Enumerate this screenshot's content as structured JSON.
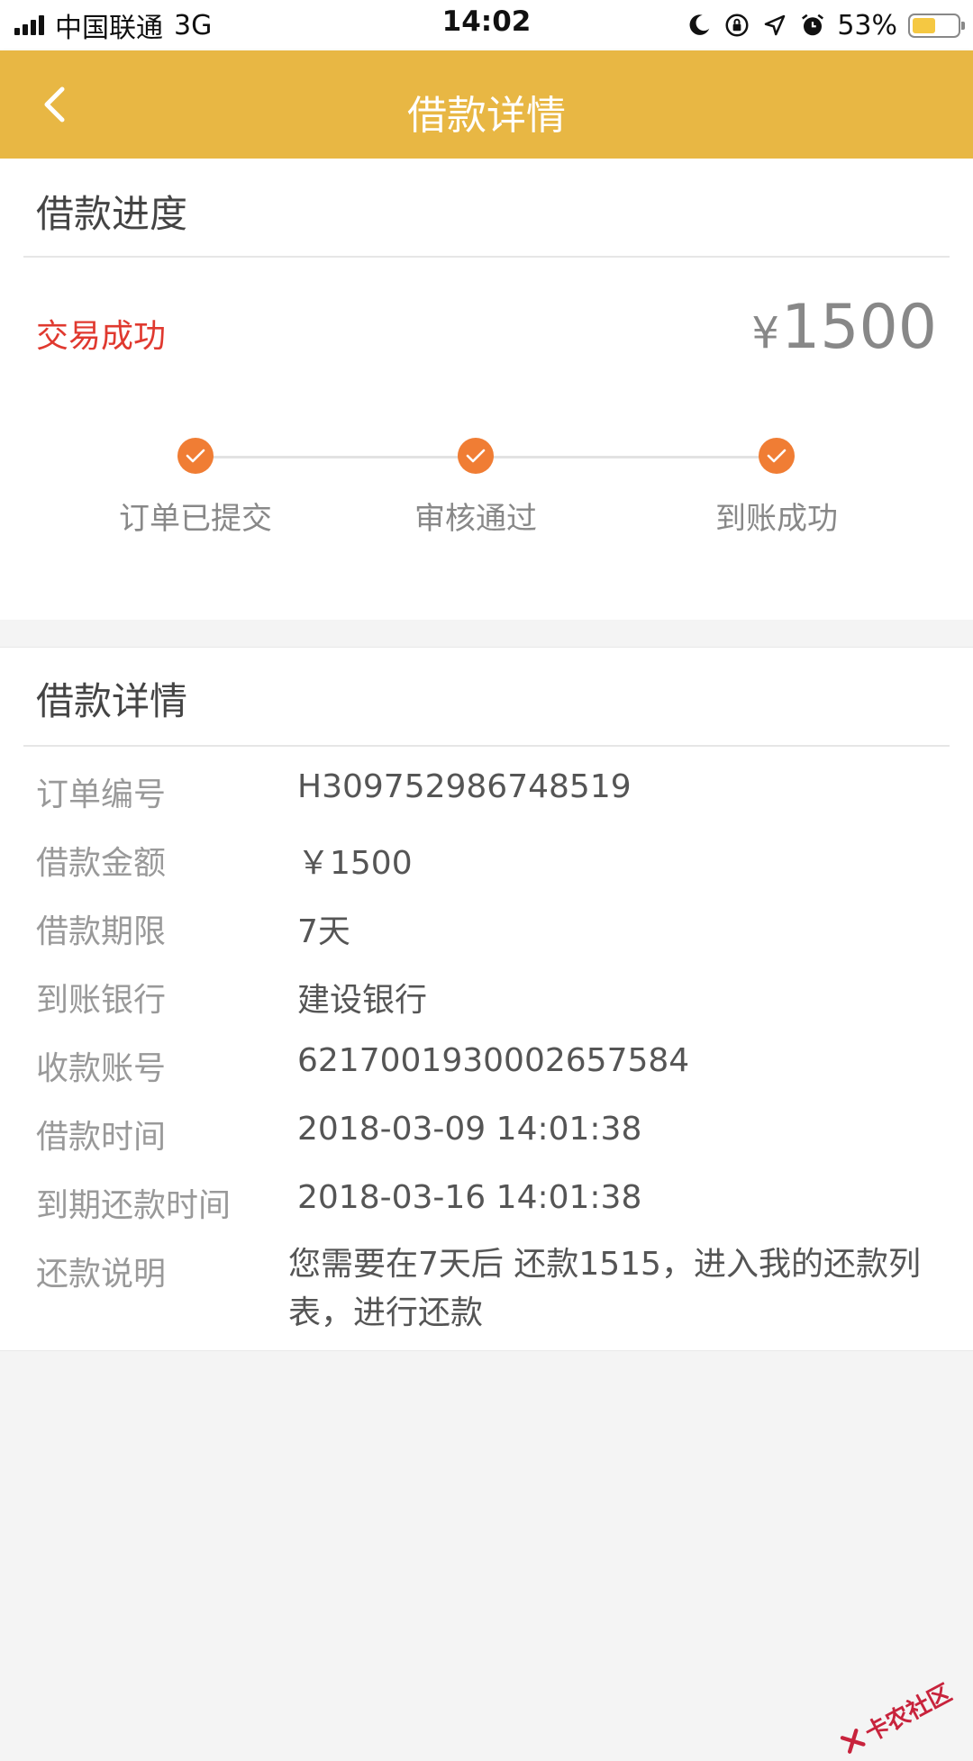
{
  "status_bar": {
    "carrier": "中国联通",
    "network": "3G",
    "time": "14:02",
    "battery_percent": "53%",
    "battery_level": 0.53
  },
  "header": {
    "title": "借款详情"
  },
  "progress": {
    "section_title": "借款进度",
    "status": "交易成功",
    "currency_symbol": "¥",
    "amount": "1500",
    "steps": [
      {
        "label": "订单已提交",
        "done": true
      },
      {
        "label": "审核通过",
        "done": true
      },
      {
        "label": "到账成功",
        "done": true
      }
    ]
  },
  "details": {
    "section_title": "借款详情",
    "rows": [
      {
        "label": "订单编号",
        "value": "H309752986748519"
      },
      {
        "label": "借款金额",
        "value": "￥1500"
      },
      {
        "label": "借款期限",
        "value": "7天"
      },
      {
        "label": "到账银行",
        "value": "建设银行"
      },
      {
        "label": "收款账号",
        "value": "6217001930002657584"
      },
      {
        "label": "借款时间",
        "value": "2018-03-09 14:01:38"
      },
      {
        "label": "到期还款时间",
        "value": "2018-03-16 14:01:38"
      },
      {
        "label": "还款说明",
        "value": "您需要在7天后 还款1515，进入我的还款列表，进行还款"
      }
    ]
  },
  "watermark": {
    "text": "卡农社区"
  },
  "colors": {
    "header_bg": "#e8b744",
    "status_success": "#e0392f",
    "step_done": "#f07d34",
    "watermark": "#c8233c"
  }
}
